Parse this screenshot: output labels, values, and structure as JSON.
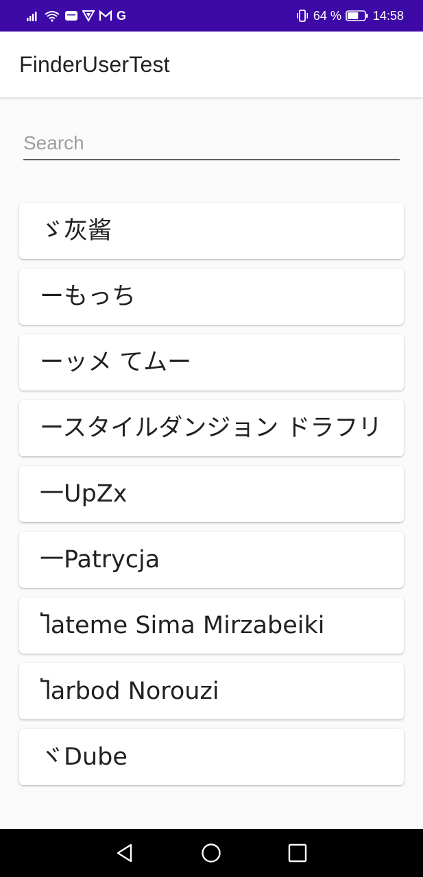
{
  "status_bar": {
    "carrier_g": "G",
    "battery_percent": "64 %",
    "time": "14:58",
    "icons": [
      "signal-icon",
      "wifi-icon",
      "message-icon",
      "vpn-shield-icon",
      "gmail-icon",
      "google-icon",
      "vibrate-icon",
      "battery-icon"
    ],
    "battery_level": 0.64
  },
  "app_bar": {
    "title": "FinderUserTest"
  },
  "search": {
    "placeholder": "Search",
    "value": ""
  },
  "users": [
    {
      "label": "ゞ灰酱"
    },
    {
      "label": "ーもっち"
    },
    {
      "label": "ーッメ てムー"
    },
    {
      "label": "ースタイルダンジョン ドラフリ"
    },
    {
      "label": "一UpZx"
    },
    {
      "label": "一Patrycja"
    },
    {
      "label": "Ⴈateme Sima Mirzabeiki"
    },
    {
      "label": "Ⴈarbod Norouzi"
    },
    {
      "label": "ヾDube"
    }
  ],
  "nav_bar": {
    "icons": [
      "back-triangle-icon",
      "home-circle-icon",
      "recents-square-icon"
    ]
  },
  "colors": {
    "status_bar": "#3d0aa8",
    "background": "#fafafa",
    "card": "#ffffff",
    "nav_bar": "#000000"
  }
}
